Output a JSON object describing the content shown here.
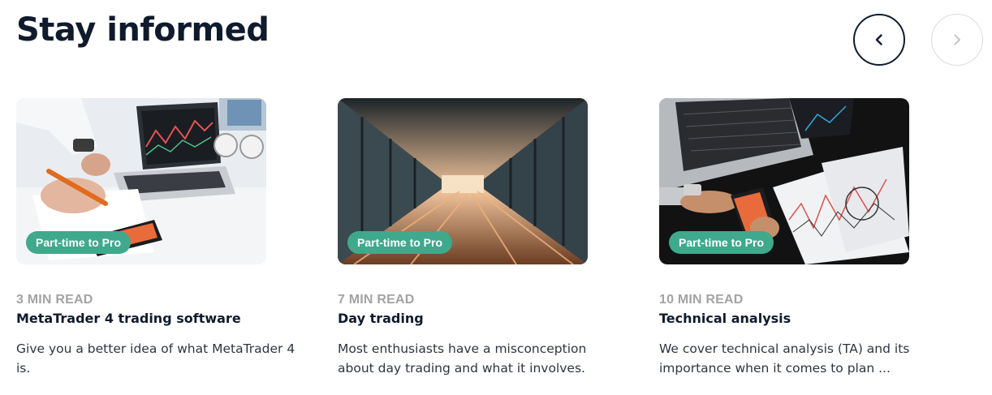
{
  "header": {
    "title": "Stay informed"
  },
  "carousel": {
    "prev_icon": "chevron-left-icon",
    "next_icon": "chevron-right-icon"
  },
  "cards": [
    {
      "tag": "Part-time to Pro",
      "read_time": "3 MIN READ",
      "title": "MetaTrader 4 trading software",
      "description": "Give you a better idea of what MetaTrader 4 is."
    },
    {
      "tag": "Part-time to Pro",
      "read_time": "7 MIN READ",
      "title": "Day trading",
      "description": "Most enthusiasts have a misconception about day trading and what it involves."
    },
    {
      "tag": "Part-time to Pro",
      "read_time": "10 MIN READ",
      "title": "Technical analysis",
      "description": "We cover technical analysis (TA) and its importance when it comes to plan ..."
    }
  ],
  "colors": {
    "heading": "#0f1b2d",
    "tag_bg": "#3fa98c",
    "read_time": "#a3a3a3"
  }
}
